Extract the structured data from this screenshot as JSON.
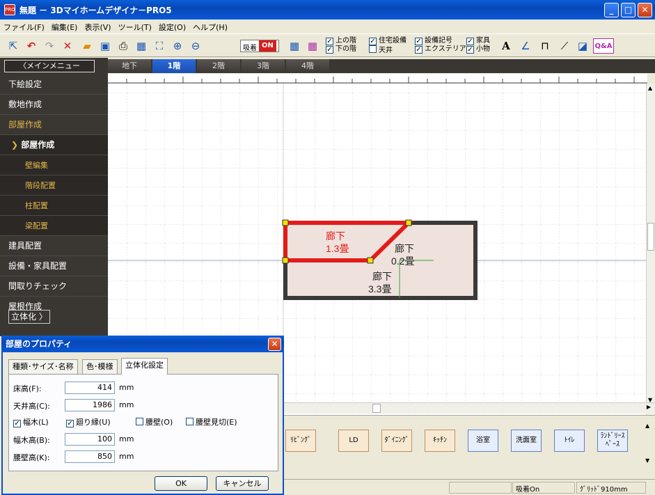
{
  "window": {
    "title": "無題 － 3Dマイホームデザイナ－PRO5",
    "app_badge": "PRO"
  },
  "menubar": [
    "ファイル(F)",
    "編集(E)",
    "表示(V)",
    "ツール(T)",
    "設定(O)",
    "ヘルプ(H)"
  ],
  "toolbar": {
    "snap_label": "吸着",
    "snap_state": "ON",
    "checks_col1": [
      "上の階",
      "下の階"
    ],
    "checks_col2": [
      "住宅設備",
      "天井"
    ],
    "checks_col3": [
      "設備記号",
      "エクステリア"
    ],
    "checks_col4": [
      "家具",
      "小物"
    ],
    "qa_label": "Q&A"
  },
  "left_menu": {
    "main_menu_label": "メインメニュー",
    "items": [
      {
        "label": "下絵設定"
      },
      {
        "label": "敷地作成"
      },
      {
        "label": "部屋作成"
      },
      {
        "label": "部屋作成"
      },
      {
        "label": "壁編集"
      },
      {
        "label": "階段配置"
      },
      {
        "label": "柱配置"
      },
      {
        "label": "梁配置"
      },
      {
        "label": "建具配置"
      },
      {
        "label": "設備・家具配置"
      },
      {
        "label": "間取りチェック"
      },
      {
        "label": "屋根作成"
      }
    ],
    "rittai_label": "立体化"
  },
  "floor_tabs": [
    "地下",
    "1階",
    "2階",
    "3階",
    "4階"
  ],
  "canvas": {
    "rooms": [
      {
        "name": "廊下",
        "size": "1.3畳",
        "selected": true
      },
      {
        "name": "廊下",
        "size": "0.2畳",
        "selected": false
      },
      {
        "name": "廊下",
        "size": "3.3畳",
        "selected": false
      }
    ],
    "colors": {
      "selected": "#e31b1b",
      "wall": "#3a3a3a",
      "floor": "#efe2dc"
    }
  },
  "palette": {
    "buttons": [
      "ﾘﾋﾞﾝｸﾞ",
      "LD",
      "ﾀﾞｲﾆﾝｸﾞ",
      "ｷｯﾁﾝ",
      "浴室",
      "洗面室",
      "ﾄｲﾚ",
      "ﾗﾝﾄﾞﾘｰｽﾍﾟｰｽ"
    ]
  },
  "statusbar": {
    "snap": "吸着On",
    "grid": "ｸﾞﾘｯﾄﾞ910mm"
  },
  "dialog": {
    "title": "部屋のプロパティ",
    "tabs": [
      "種類･サイズ･名称",
      "色･模様",
      "立体化設定"
    ],
    "floor_height_label": "床高(F):",
    "floor_height": "414",
    "ceiling_height_label": "天井高(C):",
    "ceiling_height": "1986",
    "unit": "mm",
    "checks": [
      {
        "label": "幅木(L)",
        "checked": true
      },
      {
        "label": "廻り縁(U)",
        "checked": true
      },
      {
        "label": "腰壁(O)",
        "checked": false
      },
      {
        "label": "腰壁見切(E)",
        "checked": false
      }
    ],
    "baseboard_height_label": "幅木高(B):",
    "baseboard_height": "100",
    "waist_height_label": "腰壁高(K):",
    "waist_height": "850",
    "ok_label": "OK",
    "cancel_label": "キャンセル"
  }
}
